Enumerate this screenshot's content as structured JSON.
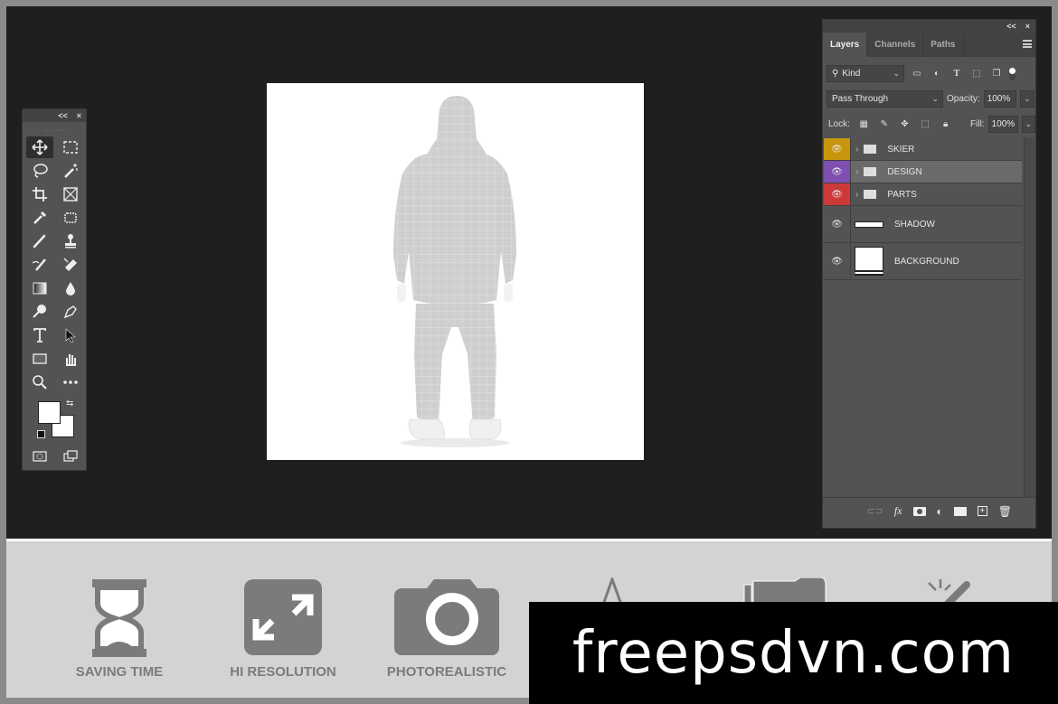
{
  "toolbar": {
    "collapse_label": "<<",
    "close_label": "×",
    "tools": [
      {
        "name": "move-tool",
        "active": true
      },
      {
        "name": "rectangular-marquee-tool"
      },
      {
        "name": "lasso-tool"
      },
      {
        "name": "magic-wand-tool"
      },
      {
        "name": "crop-tool"
      },
      {
        "name": "frame-tool"
      },
      {
        "name": "eyedropper-tool"
      },
      {
        "name": "spot-healing-tool"
      },
      {
        "name": "brush-tool"
      },
      {
        "name": "clone-stamp-tool"
      },
      {
        "name": "history-brush-tool"
      },
      {
        "name": "eraser-tool"
      },
      {
        "name": "gradient-tool"
      },
      {
        "name": "blur-tool"
      },
      {
        "name": "dodge-tool"
      },
      {
        "name": "pen-tool"
      },
      {
        "name": "type-tool"
      },
      {
        "name": "path-selection-tool"
      },
      {
        "name": "rectangle-tool"
      },
      {
        "name": "hand-tool"
      },
      {
        "name": "zoom-tool"
      },
      {
        "name": "more-tools"
      }
    ],
    "foreground_color": "#ffffff",
    "background_color": "#ffffff"
  },
  "layers_panel": {
    "collapse_label": "<<",
    "close_label": "×",
    "tabs": [
      {
        "label": "Layers",
        "active": true
      },
      {
        "label": "Channels",
        "active": false
      },
      {
        "label": "Paths",
        "active": false
      }
    ],
    "filter": {
      "value": "Kind"
    },
    "blend_mode": {
      "value": "Pass Through"
    },
    "opacity": {
      "label": "Opacity:",
      "value": "100%"
    },
    "lock": {
      "label": "Lock:"
    },
    "fill": {
      "label": "Fill:",
      "value": "100%"
    },
    "layers": [
      {
        "name": "SKIER",
        "type": "group",
        "color": "#c8960c",
        "selected": false
      },
      {
        "name": "DESIGN",
        "type": "group",
        "color": "#7e4fb0",
        "selected": true
      },
      {
        "name": "PARTS",
        "type": "group",
        "color": "#cc3a3a",
        "selected": false
      },
      {
        "name": "SHADOW",
        "type": "layer",
        "color": null,
        "selected": false
      },
      {
        "name": "BACKGROUND",
        "type": "layer",
        "color": null,
        "selected": false
      }
    ]
  },
  "features": [
    {
      "label": "SAVING TIME",
      "icon": "hourglass-icon"
    },
    {
      "label": "HI RESOLUTION",
      "icon": "expand-arrows-icon"
    },
    {
      "label": "PHOTOREALISTIC",
      "icon": "camera-icon"
    }
  ],
  "watermark": {
    "text": "freepsdvn.com"
  }
}
